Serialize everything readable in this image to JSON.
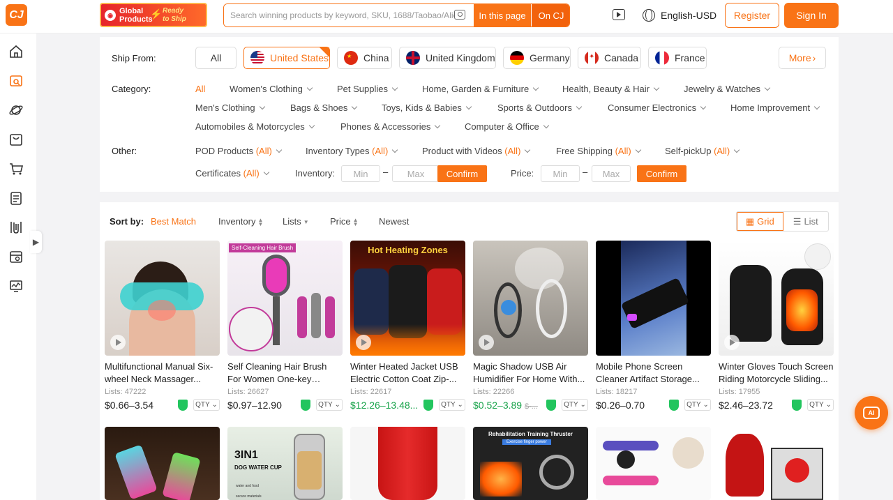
{
  "brand": {
    "logo": "CJ",
    "banner_left": "Global Products",
    "banner_right": "Ready to Ship"
  },
  "search": {
    "placeholder": "Search winning products by keyword, SKU, 1688/Taobao/Alie...",
    "btn_page": "In this page",
    "btn_cj": "On CJ"
  },
  "header": {
    "language": "English-USD",
    "register": "Register",
    "signin": "Sign In"
  },
  "ship_from": {
    "label": "Ship From:",
    "options": [
      "All",
      "United States",
      "China",
      "United Kingdom",
      "Germany",
      "Canada",
      "France"
    ],
    "selected": "United States",
    "more": "More"
  },
  "category": {
    "label": "Category:",
    "items": [
      "All",
      "Women's Clothing",
      "Pet Supplies",
      "Home, Garden & Furniture",
      "Health, Beauty & Hair",
      "Jewelry & Watches",
      "Men's Clothing",
      "Bags & Shoes",
      "Toys, Kids & Babies",
      "Sports & Outdoors",
      "Consumer Electronics",
      "Home Improvement",
      "Automobiles & Motorcycles",
      "Phones & Accessories",
      "Computer & Office"
    ]
  },
  "other": {
    "label": "Other:",
    "all_text": "(All)",
    "items": [
      "POD Products",
      "Inventory Types",
      "Product with Videos",
      "Free Shipping",
      "Self-pickUp",
      "Certificates"
    ],
    "inventory_label": "Inventory:",
    "price_label": "Price:",
    "min": "Min",
    "max": "Max",
    "dash": "–",
    "confirm": "Confirm"
  },
  "sort": {
    "label": "Sort by:",
    "options": [
      "Best Match",
      "Inventory",
      "Lists",
      "Price",
      "Newest"
    ],
    "active": "Best Match"
  },
  "view": {
    "grid": "Grid",
    "list": "List",
    "active": "Grid"
  },
  "products": [
    {
      "title": "Multifunctional Manual Six-wheel Neck Massager...",
      "lists_label": "Lists:",
      "lists": "47222",
      "price": "$0.66–3.54",
      "green": false,
      "qty": "QTY"
    },
    {
      "title": "Self Cleaning Hair Brush For Women One-key Cleaning...",
      "lists_label": "Lists:",
      "lists": "26627",
      "price": "$0.97–12.90",
      "green": false,
      "qty": "QTY",
      "tag": "Self-Cleaning Hair Brush"
    },
    {
      "title": "Winter Heated Jacket USB Electric Cotton Coat Zip-...",
      "lists_label": "Lists:",
      "lists": "22617",
      "price": "$12.26–13.48...",
      "green": true,
      "qty": "QTY",
      "tag": "Hot Heating Zones"
    },
    {
      "title": "Magic Shadow USB Air Humidifier For Home With...",
      "lists_label": "Lists:",
      "lists": "22266",
      "price": "$0.52–3.89",
      "old": "$-...",
      "green": true,
      "qty": "QTY"
    },
    {
      "title": "Mobile Phone Screen Cleaner Artifact Storage...",
      "lists_label": "Lists:",
      "lists": "18217",
      "price": "$0.26–0.70",
      "green": false,
      "qty": "QTY"
    },
    {
      "title": "Winter Gloves Touch Screen Riding Motorcycle Sliding...",
      "lists_label": "Lists:",
      "lists": "17955",
      "price": "$2.46–23.72",
      "green": false,
      "qty": "QTY"
    }
  ],
  "row2_tags": {
    "dog_cup_title": "3IN1",
    "dog_cup_sub": "DOG WATER CUP",
    "dog_cup_small1": "water and food",
    "dog_cup_small2": "secure materials",
    "thruster": "Rehabilitation Training Thruster",
    "thruster_sub": "Exercise finger power"
  },
  "ai": "AI",
  "colors": {
    "accent": "#f97316",
    "green": "#18a34a"
  }
}
